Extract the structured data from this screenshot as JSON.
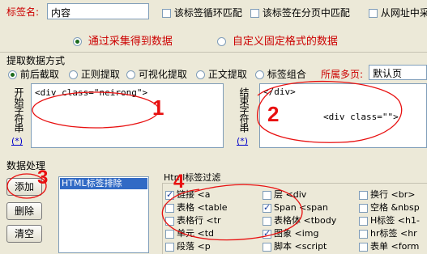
{
  "tag_name": {
    "label": "标签名:",
    "value": "内容"
  },
  "top_checks": [
    {
      "label": "该标签循环匹配",
      "checked": false
    },
    {
      "label": "该标签在分页中匹配",
      "checked": false
    },
    {
      "label": "从网址中采",
      "checked": false
    }
  ],
  "mode": {
    "collect": "通过采集得到数据",
    "fixed": "自定义固定格式的数据",
    "selected": "collect"
  },
  "extract": {
    "section_label": "提取数据方式",
    "options": [
      "前后截取",
      "正则提取",
      "可视化提取",
      "正文提取",
      "标签组合"
    ],
    "selected": 0,
    "page_label": "所属多页:",
    "page_value": "默认页"
  },
  "start_string": {
    "label": "开始字符串",
    "link": "(*)",
    "content": "<div class=\"neirong\">"
  },
  "end_string": {
    "label": "结束字符串",
    "link": "(*)",
    "content_line1": "</div>",
    "content_line2": "<div class=\"\">"
  },
  "processing": {
    "section_label": "数据处理",
    "buttons": {
      "add": "添加",
      "delete": "删除",
      "clear": "清空"
    },
    "list_items": [
      "HTML标签排除"
    ]
  },
  "filter": {
    "section_label": "Html标签过滤",
    "items": [
      [
        {
          "label": "链接 <a",
          "checked": true
        },
        {
          "label": "表格 <table",
          "checked": false
        },
        {
          "label": "表格行 <tr",
          "checked": false
        },
        {
          "label": "单元 <td",
          "checked": false
        },
        {
          "label": "段落 <p",
          "checked": false
        }
      ],
      [
        {
          "label": "层 <div",
          "checked": false
        },
        {
          "label": "Span <span",
          "checked": true
        },
        {
          "label": "表格体 <tbody",
          "checked": false
        },
        {
          "label": "图象 <img",
          "checked": true
        },
        {
          "label": "脚本 <script",
          "checked": false
        }
      ],
      [
        {
          "label": "换行 <br>",
          "checked": false
        },
        {
          "label": "空格 &nbsp",
          "checked": false
        },
        {
          "label": "H标签 <h1-",
          "checked": false
        },
        {
          "label": "hr标签 <hr",
          "checked": false
        },
        {
          "label": "表单 <form",
          "checked": false
        }
      ]
    ]
  },
  "annotations": [
    "1",
    "2",
    "3",
    "4"
  ],
  "colors": {
    "accent_red": "#cc0000",
    "annotation_red": "#e81010",
    "link_blue": "#0000cc",
    "list_highlight": "#316ac5"
  }
}
